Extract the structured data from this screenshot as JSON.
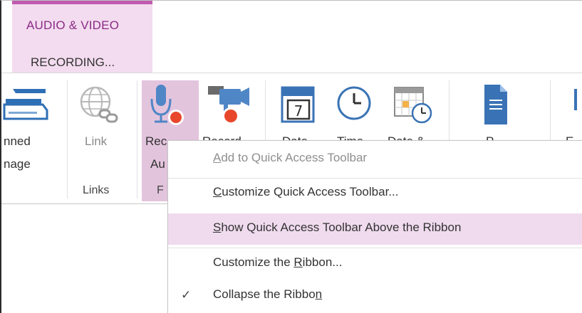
{
  "contextual_tab": {
    "group_title": "AUDIO & VIDEO",
    "tab_label": "RECORDING..."
  },
  "ribbon": {
    "scanned_image": {
      "line1": "nned",
      "line2": "nage"
    },
    "link": {
      "label": "Link"
    },
    "links_group_label": "Links",
    "record_audio": {
      "line1": "Rec",
      "line2": "Au"
    },
    "record_video": {
      "line1": "Record"
    },
    "date": {
      "line1": "Date"
    },
    "time": {
      "line1": "Time"
    },
    "date_time": {
      "line1": "Date &"
    },
    "page_templates": {
      "line1": "P"
    },
    "equation": {
      "line1": "E"
    },
    "partial_group_label": "F"
  },
  "context_menu": {
    "items": [
      {
        "pre": "",
        "u": "A",
        "post": "dd to Quick Access Toolbar",
        "state": "disabled"
      },
      {
        "pre": "",
        "u": "C",
        "post": "ustomize Quick Access Toolbar...",
        "state": "normal"
      },
      {
        "pre": "",
        "u": "S",
        "post": "how Quick Access Toolbar Above the Ribbon",
        "state": "highlighted"
      },
      {
        "pre": "Customize the ",
        "u": "R",
        "post": "ibbon...",
        "state": "normal"
      },
      {
        "pre": "Collapse the Ribbo",
        "u": "n",
        "post": "",
        "state": "checked"
      }
    ],
    "check_mark": "✓"
  },
  "colors": {
    "accent": "#c05bb0",
    "context_tab_bg": "#f3dcef",
    "pressed_bg": "#e3c4dd",
    "menu_highlight": "#f0dbee"
  }
}
